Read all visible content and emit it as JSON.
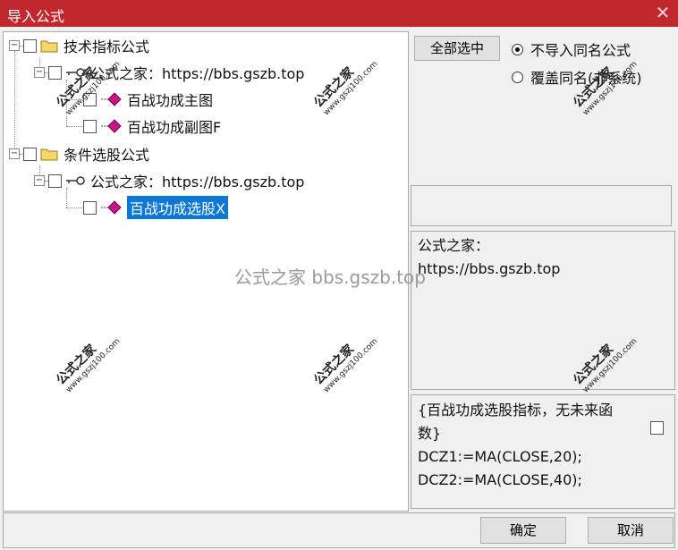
{
  "window": {
    "title": "导入公式",
    "close_glyph": "✕"
  },
  "tree": {
    "nodes": [
      {
        "label": "技术指标公式",
        "type": "folder"
      },
      {
        "label": "公式之家：https://bbs.gszb.top",
        "type": "key"
      },
      {
        "label": "百战功成主图",
        "type": "formula"
      },
      {
        "label": "百战功成副图F",
        "type": "formula"
      },
      {
        "label": "条件选股公式",
        "type": "folder"
      },
      {
        "label": "公式之家：https://bbs.gszb.top",
        "type": "key"
      },
      {
        "label": "百战功成选股X",
        "type": "formula",
        "selected": true
      }
    ],
    "expander_glyph": "−"
  },
  "options": {
    "select_all": "全部选中",
    "radio_no_import": "不导入同名公式",
    "radio_overwrite": "覆盖同名(非系统)",
    "selected_radio": "no_import"
  },
  "info": {
    "line1": "公式之家：",
    "line2": "https://bbs.gszb.top"
  },
  "code": {
    "line1": "{百战功成选股指标，无未来函",
    "line2": "数}",
    "line3": "DCZ1:=MA(CLOSE,20);",
    "line4": "DCZ2:=MA(CLOSE,40);"
  },
  "buttons": {
    "ok": "确定",
    "cancel": "取消"
  },
  "watermarks": {
    "brand": "公式之家",
    "site": "www.gszj100.com",
    "center": "公式之家 bbs.gszb.top"
  },
  "colors": {
    "titlebar": "#c0282e",
    "selection": "#0b78d7",
    "formula_icon": "#c71585"
  }
}
